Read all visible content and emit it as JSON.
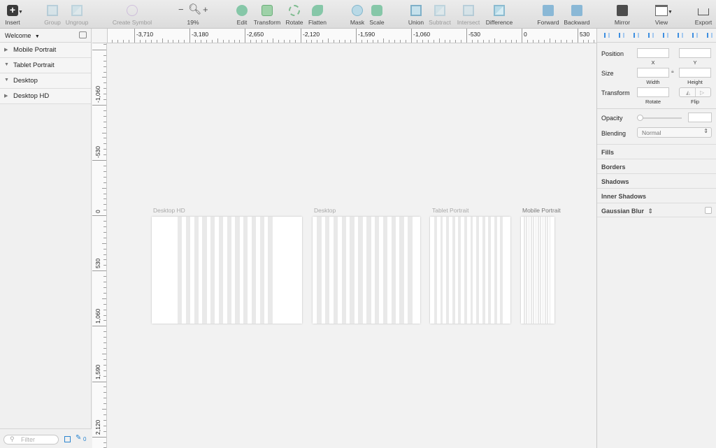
{
  "toolbar": {
    "insert": "Insert",
    "group": "Group",
    "ungroup": "Ungroup",
    "create_symbol": "Create Symbol",
    "zoom_out": "−",
    "zoom_in": "+",
    "zoom_level": "19%",
    "edit": "Edit",
    "transform": "Transform",
    "rotate": "Rotate",
    "flatten": "Flatten",
    "mask": "Mask",
    "scale": "Scale",
    "union": "Union",
    "subtract": "Subtract",
    "intersect": "Intersect",
    "difference": "Difference",
    "forward": "Forward",
    "backward": "Backward",
    "mirror": "Mirror",
    "view": "View",
    "export": "Export"
  },
  "layers": {
    "page": "Welcome",
    "items": [
      {
        "label": "Mobile Portrait",
        "expanded": false
      },
      {
        "label": "Tablet Portrait",
        "expanded": true
      },
      {
        "label": "Desktop",
        "expanded": true
      },
      {
        "label": "Desktop HD",
        "expanded": false
      }
    ],
    "filter_placeholder": "Filter",
    "edit_count": "0"
  },
  "ruler": {
    "h_labels": [
      "-3,710",
      "-3,180",
      "-2,650",
      "-2,120",
      "-1,590",
      "-1,060",
      "-530",
      "0",
      "530"
    ],
    "v_labels": [
      "-1,060",
      "-530",
      "0",
      "530",
      "1,060",
      "1,590",
      "2,120"
    ]
  },
  "artboards": [
    {
      "title": "Desktop HD",
      "columns": 12
    },
    {
      "title": "Desktop",
      "columns": 12
    },
    {
      "title": "Tablet Portrait",
      "columns": 12
    },
    {
      "title": "Mobile Portrait",
      "columns": 12
    }
  ],
  "inspector": {
    "position": "Position",
    "x": "X",
    "y": "Y",
    "size": "Size",
    "width": "Width",
    "height": "Height",
    "transform": "Transform",
    "rotate": "Rotate",
    "flip": "Flip",
    "opacity": "Opacity",
    "blending": "Blending",
    "blend_mode": "Normal",
    "fills": "Fills",
    "borders": "Borders",
    "shadows": "Shadows",
    "inner_shadows": "Inner Shadows",
    "gaussian_blur": "Gaussian Blur"
  },
  "colors": {
    "accent": "#2a85d0",
    "canvas": "#f2f2f2",
    "grid_column": "#e9e9e9"
  }
}
